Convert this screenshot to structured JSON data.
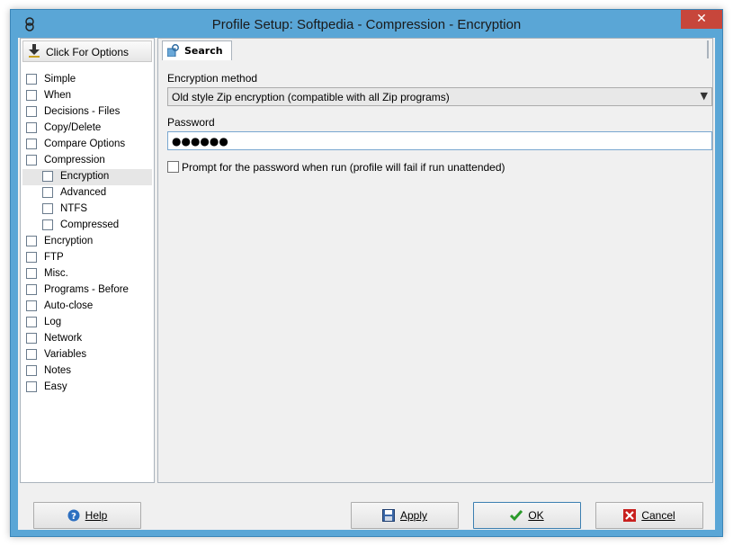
{
  "window": {
    "title": "Profile Setup: Softpedia - Compression - Encryption",
    "close_label": "✕"
  },
  "nav": {
    "header_label": "Click For Options",
    "items": [
      {
        "label": "Simple",
        "icon": "simple-icon",
        "sub": false
      },
      {
        "label": "When",
        "icon": "when-icon",
        "sub": false
      },
      {
        "label": "Decisions - Files",
        "icon": "decisions-icon",
        "sub": false
      },
      {
        "label": "Copy/Delete",
        "icon": "copy-delete-icon",
        "sub": false
      },
      {
        "label": "Compare Options",
        "icon": "compare-icon",
        "sub": false
      },
      {
        "label": "Compression",
        "icon": "compression-icon",
        "sub": false
      },
      {
        "label": "Encryption",
        "icon": "lock-icon",
        "sub": true,
        "selected": true
      },
      {
        "label": "Advanced",
        "icon": "advanced-icon",
        "sub": true
      },
      {
        "label": "NTFS",
        "icon": "ntfs-icon",
        "sub": true
      },
      {
        "label": "Compressed",
        "icon": "compressed-icon",
        "sub": true
      },
      {
        "label": "Encryption",
        "icon": "lock-icon",
        "sub": false
      },
      {
        "label": "FTP",
        "icon": "ftp-icon",
        "sub": false
      },
      {
        "label": "Misc.",
        "icon": "misc-icon",
        "sub": false
      },
      {
        "label": "Programs - Before",
        "icon": "programs-icon",
        "sub": false
      },
      {
        "label": "Auto-close",
        "icon": "auto-close-icon",
        "sub": false
      },
      {
        "label": "Log",
        "icon": "log-icon",
        "sub": false
      },
      {
        "label": "Network",
        "icon": "network-icon",
        "sub": false
      },
      {
        "label": "Variables",
        "icon": "variables-icon",
        "sub": false
      },
      {
        "label": "Notes",
        "icon": "notes-icon",
        "sub": false
      },
      {
        "label": "Easy",
        "icon": "easy-icon",
        "sub": false
      }
    ]
  },
  "panel": {
    "tab_label": "Search",
    "encryption_method_label": "Encryption method",
    "encryption_method_value": "Old style Zip encryption (compatible with all Zip programs)",
    "password_label": "Password",
    "password_value": "●●●●●●",
    "prompt_label": "Prompt for the password when run (profile will fail if run unattended)",
    "prompt_checked": false
  },
  "buttons": {
    "help": "Help",
    "apply": "Apply",
    "ok": "OK",
    "cancel": "Cancel"
  },
  "colors": {
    "titlebar": "#5aa6d6",
    "close": "#c7463b",
    "ok_check": "#2a9a2a",
    "cancel_x": "#c8201e"
  }
}
